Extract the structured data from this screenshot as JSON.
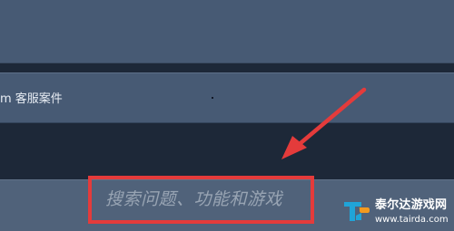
{
  "panels": {
    "support_item": {
      "label": "m 客服案件"
    }
  },
  "search": {
    "placeholder": "搜索问题、功能和游戏"
  },
  "watermark": {
    "title": "泰尔达游戏网",
    "url": "www.tairda.com"
  },
  "colors": {
    "background": "#1d2838",
    "panel": "#475a74",
    "search_row": "#50627a",
    "annotation": "#e43b3b",
    "logo_blue": "#20a4d8",
    "logo_orange": "#f39a1f"
  },
  "icons": {
    "arrow": "red-annotation-arrow-icon",
    "logo": "tairda-logo-icon"
  }
}
